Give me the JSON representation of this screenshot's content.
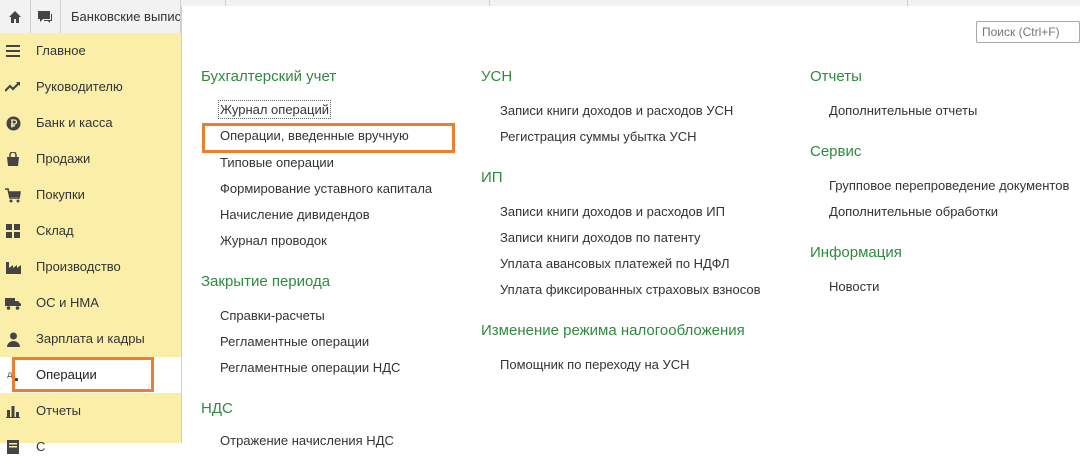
{
  "topbar": {
    "home_icon": "home-icon",
    "chat_icon": "chat-icon",
    "tab_label": "Банковские выпис"
  },
  "sidebar": {
    "items": [
      {
        "label": "Главное",
        "icon": "menu-lines-icon"
      },
      {
        "label": "Руководителю",
        "icon": "trend-up-icon"
      },
      {
        "label": "Банк и касса",
        "icon": "ruble-coin-icon"
      },
      {
        "label": "Продажи",
        "icon": "shopping-bag-icon"
      },
      {
        "label": "Покупки",
        "icon": "cart-icon"
      },
      {
        "label": "Склад",
        "icon": "warehouse-grid-icon"
      },
      {
        "label": "Производство",
        "icon": "factory-icon"
      },
      {
        "label": "ОС и НМА",
        "icon": "truck-icon"
      },
      {
        "label": "Зарплата и кадры",
        "icon": "person-icon"
      },
      {
        "label": "Операции",
        "icon": "operations-icon"
      },
      {
        "label": "Отчеты",
        "icon": "bar-chart-icon"
      },
      {
        "label": "С",
        "icon": "document-icon"
      }
    ]
  },
  "search": {
    "placeholder": "Поиск (Ctrl+F)"
  },
  "sections": {
    "accounting": {
      "title": "Бухгалтерский учет",
      "links": [
        "Журнал операций",
        "Операции, введенные вручную",
        "Типовые операции",
        "Формирование уставного капитала",
        "Начисление дивидендов",
        "Журнал проводок"
      ]
    },
    "closing": {
      "title": "Закрытие периода",
      "links": [
        "Справки-расчеты",
        "Регламентные операции",
        "Регламентные операции НДС"
      ]
    },
    "vat": {
      "title": "НДС",
      "links": [
        "Отражение начисления НДС"
      ]
    },
    "usn": {
      "title": "УСН",
      "links": [
        "Записи книги доходов и расходов УСН",
        "Регистрация суммы убытка УСН"
      ]
    },
    "ip": {
      "title": "ИП",
      "links": [
        "Записи книги доходов и расходов ИП",
        "Записи книги доходов по патенту",
        "Уплата авансовых платежей по НДФЛ",
        "Уплата фиксированных страховых взносов"
      ]
    },
    "tax_mode": {
      "title": "Изменение режима налогообложения",
      "links": [
        "Помощник по переходу на УСН"
      ]
    },
    "reports": {
      "title": "Отчеты",
      "links": [
        "Дополнительные отчеты"
      ]
    },
    "service": {
      "title": "Сервис",
      "links": [
        "Групповое перепроведение документов",
        "Дополнительные обработки"
      ]
    },
    "info": {
      "title": "Информация",
      "links": [
        "Новости"
      ]
    }
  },
  "colors": {
    "sidebar_bg": "#fbeea8",
    "section_title": "#2e8b3e",
    "highlight": "#ed7d31"
  }
}
